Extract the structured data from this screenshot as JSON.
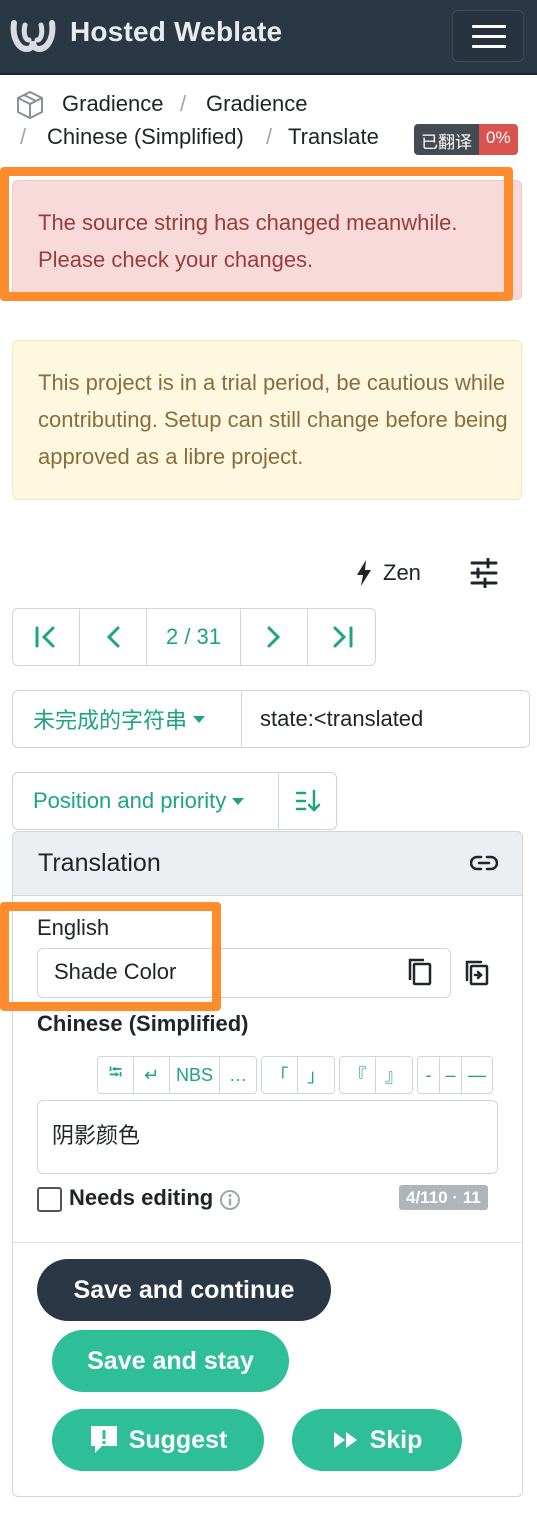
{
  "header": {
    "brand": "Hosted Weblate"
  },
  "breadcrumb": {
    "project": "Gradience",
    "component": "Gradience",
    "language": "Chinese (Simplified)",
    "page": "Translate"
  },
  "badge": {
    "label": "已翻译",
    "percent": "0%"
  },
  "alerts": {
    "changed": "The source string has changed meanwhile. Please check your changes.",
    "trial": "This project is in a trial period, be cautious while contributing. Setup can still change before being approved as a libre project."
  },
  "toolbar": {
    "zen_label": "Zen"
  },
  "pager": {
    "position": "2 / 31"
  },
  "filter": {
    "label": "未完成的字符串",
    "query": "state:<translated"
  },
  "sort": {
    "label": "Position and priority"
  },
  "editor": {
    "title": "Translation",
    "source_lang": "English",
    "source_text": "Shade Color",
    "target_lang": "Chinese (Simplified)",
    "target_text": "阴影颜色",
    "needs_editing": "Needs editing",
    "counter": "4/110 · 11",
    "special_chars": [
      [
        "⭾",
        "↵",
        "NBS",
        "…"
      ],
      [
        "「",
        "」"
      ],
      [
        "『",
        "』"
      ],
      [
        "-",
        "–",
        "—"
      ]
    ]
  },
  "buttons": {
    "save_continue": "Save and continue",
    "save_stay": "Save and stay",
    "suggest": "Suggest",
    "skip": "Skip"
  },
  "colors": {
    "navbar": "#2a3744",
    "accent": "#1fa385",
    "button_green": "#2ebf98",
    "highlight": "#ff8c2c"
  }
}
